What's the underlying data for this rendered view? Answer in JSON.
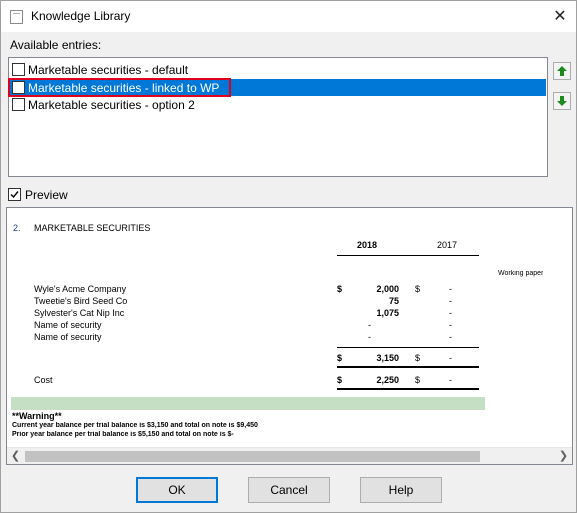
{
  "window": {
    "title": "Knowledge Library",
    "close_symbol": "✕"
  },
  "entries_label": "Available entries:",
  "entries": [
    {
      "label": "Marketable securities - default",
      "checked": false,
      "selected": false
    },
    {
      "label": "Marketable securities - linked to WP",
      "checked": false,
      "selected": true
    },
    {
      "label": "Marketable securities - option 2",
      "checked": false,
      "selected": false
    }
  ],
  "move_up_icon": "arrow-up-green",
  "move_down_icon": "arrow-down-green",
  "preview": {
    "label": "Preview",
    "checked": true,
    "note_number": "2.",
    "note_title": "MARKETABLE SECURITIES",
    "year_current": "2018",
    "year_prior": "2017",
    "working_paper_label": "Working paper",
    "rows": [
      {
        "name": "Wyle's Acme Company",
        "cur_sign": "$",
        "cur": "2,000",
        "prior_sign": "$",
        "prior": "-"
      },
      {
        "name": "Tweetie's Bird Seed Co",
        "cur_sign": "",
        "cur": "75",
        "prior_sign": "",
        "prior": "-"
      },
      {
        "name": "Sylvester's Cat Nip Inc",
        "cur_sign": "",
        "cur": "1,075",
        "prior_sign": "",
        "prior": "-"
      },
      {
        "name": "Name of security",
        "cur_sign": "",
        "cur": "-",
        "prior_sign": "",
        "prior": "-"
      },
      {
        "name": "Name of security",
        "cur_sign": "",
        "cur": "-",
        "prior_sign": "",
        "prior": "-"
      }
    ],
    "total": {
      "cur_sign": "$",
      "cur": "3,150",
      "prior_sign": "$",
      "prior": "-"
    },
    "cost": {
      "name": "Cost",
      "cur_sign": "$",
      "cur": "2,250",
      "prior_sign": "$",
      "prior": "-"
    },
    "warning_title": "**Warning**",
    "warning_line1": "Current year balance per trial balance is    $3,150  and total on note is  $9,450",
    "warning_line2": "Prior year balance per trial balance is    $5,150  and total on note is  $-",
    "green_bar_color": "#c4dfc4"
  },
  "buttons": {
    "ok": "OK",
    "cancel": "Cancel",
    "help": "Help"
  },
  "colors": {
    "selection": "#0078d7",
    "highlight_box": "#e0001b",
    "arrow_green": "#1e8a1e"
  }
}
